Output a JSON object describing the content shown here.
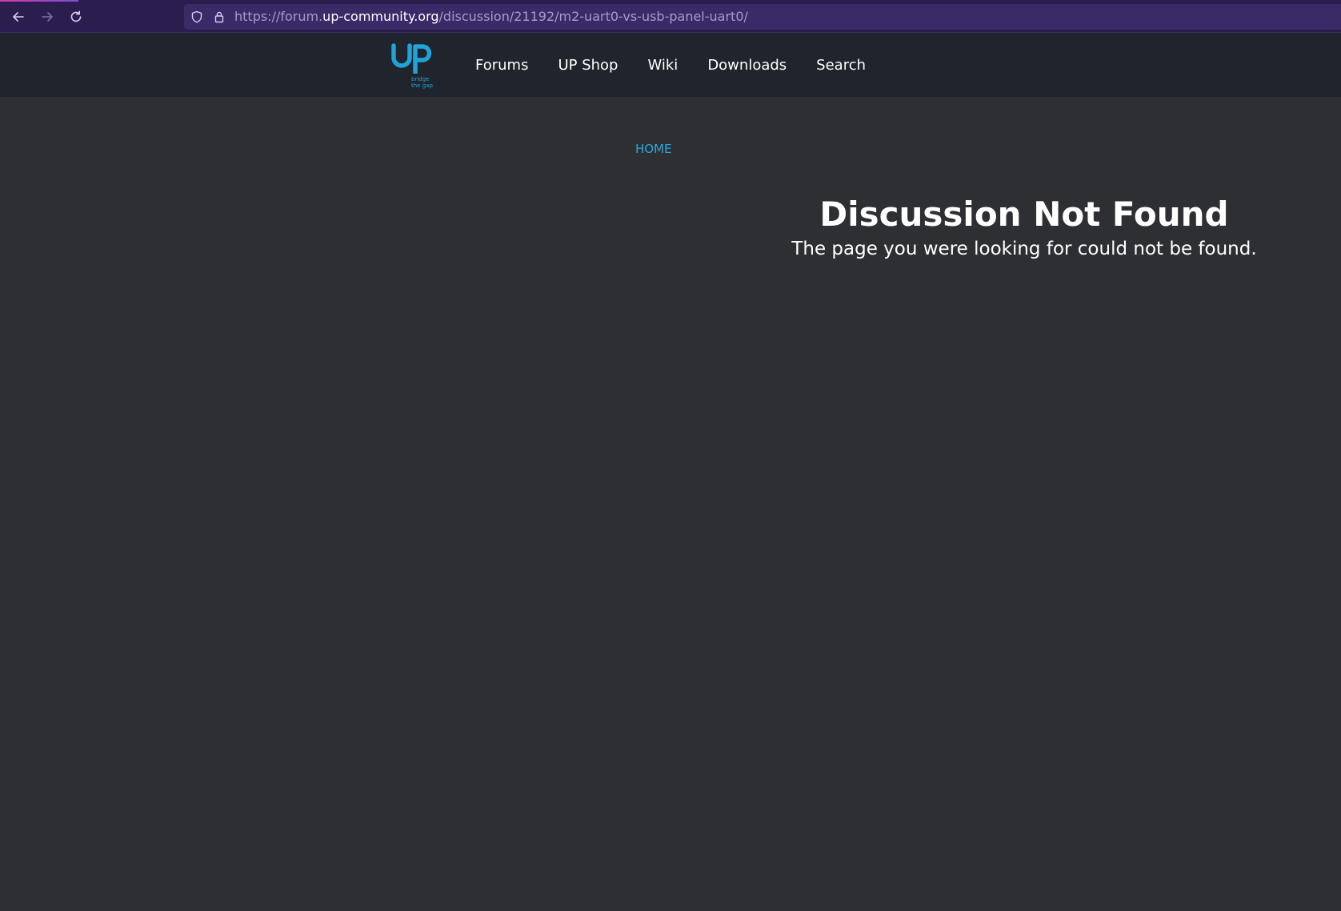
{
  "browser": {
    "url_prefix": "https://forum.",
    "url_domain": "up-community.org",
    "url_path": "/discussion/21192/m2-uart0-vs-usb-panel-uart0/",
    "accent_color": "#2b1d4d"
  },
  "header": {
    "logo_text": "UP",
    "logo_tagline_1": "bridge",
    "logo_tagline_2": "the gap",
    "logo_color": "#20a3d8",
    "nav": [
      {
        "label": "Forums"
      },
      {
        "label": "UP Shop"
      },
      {
        "label": "Wiki"
      },
      {
        "label": "Downloads"
      },
      {
        "label": "Search"
      }
    ]
  },
  "main": {
    "breadcrumb": "HOME",
    "title": "Discussion Not Found",
    "message": "The page you were looking for could not be found."
  }
}
